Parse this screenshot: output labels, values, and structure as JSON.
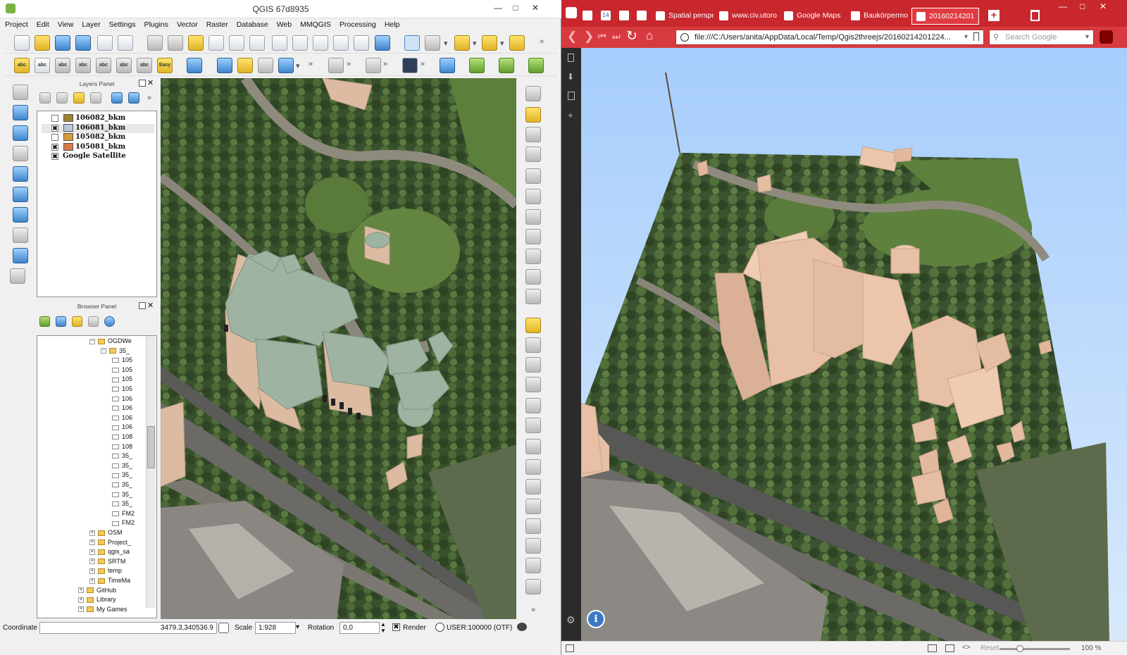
{
  "qgis": {
    "title": "QGIS 67d8935",
    "menu": [
      "Project",
      "Edit",
      "View",
      "Layer",
      "Settings",
      "Plugins",
      "Vector",
      "Raster",
      "Database",
      "Web",
      "MMQGIS",
      "Processing",
      "Help"
    ],
    "toolbar_labels": {
      "abc": "abc",
      "easy": "Easy"
    },
    "layers_panel": {
      "title": "Layers Panel",
      "layers": [
        {
          "name": "106082_bkm",
          "checked": false,
          "color": "#9c8430"
        },
        {
          "name": "106081_bkm",
          "checked": true,
          "color": "#b9c7d9"
        },
        {
          "name": "105082_bkm",
          "checked": false,
          "color": "#d99a3a"
        },
        {
          "name": "105081_bkm",
          "checked": true,
          "color": "#d87a4a"
        },
        {
          "name": "Google Satellite",
          "checked": true,
          "color": ""
        }
      ]
    },
    "browser_panel": {
      "title": "Browser Panel",
      "tree": [
        {
          "label": "OGDWe",
          "indent": 1,
          "type": "folder"
        },
        {
          "label": "35_",
          "indent": 2,
          "type": "folder"
        },
        {
          "label": "105",
          "indent": 3,
          "type": "file"
        },
        {
          "label": "105",
          "indent": 3,
          "type": "file"
        },
        {
          "label": "105",
          "indent": 3,
          "type": "file"
        },
        {
          "label": "105",
          "indent": 3,
          "type": "file"
        },
        {
          "label": "106",
          "indent": 3,
          "type": "file"
        },
        {
          "label": "106",
          "indent": 3,
          "type": "file"
        },
        {
          "label": "106",
          "indent": 3,
          "type": "file"
        },
        {
          "label": "106",
          "indent": 3,
          "type": "file"
        },
        {
          "label": "108",
          "indent": 3,
          "type": "file"
        },
        {
          "label": "108",
          "indent": 3,
          "type": "file"
        },
        {
          "label": "35_",
          "indent": 3,
          "type": "file"
        },
        {
          "label": "35_",
          "indent": 3,
          "type": "file"
        },
        {
          "label": "35_",
          "indent": 3,
          "type": "file"
        },
        {
          "label": "35_",
          "indent": 3,
          "type": "file"
        },
        {
          "label": "35_",
          "indent": 3,
          "type": "file"
        },
        {
          "label": "35_",
          "indent": 3,
          "type": "file"
        },
        {
          "label": "FM2",
          "indent": 3,
          "type": "file"
        },
        {
          "label": "FM2",
          "indent": 3,
          "type": "file"
        },
        {
          "label": "OSM",
          "indent": 1,
          "type": "folder"
        },
        {
          "label": "Project_",
          "indent": 1,
          "type": "folder"
        },
        {
          "label": "qgis_sa",
          "indent": 1,
          "type": "folder"
        },
        {
          "label": "SRTM",
          "indent": 1,
          "type": "folder"
        },
        {
          "label": "temp",
          "indent": 1,
          "type": "folder"
        },
        {
          "label": "TimeMa",
          "indent": 1,
          "type": "folder"
        },
        {
          "label": "GitHub",
          "indent": 0,
          "type": "folder"
        },
        {
          "label": "Library",
          "indent": 0,
          "type": "folder"
        },
        {
          "label": "My Games",
          "indent": 0,
          "type": "folder"
        }
      ]
    },
    "status": {
      "coordinate_label": "Coordinate",
      "coordinate_value": "3479.3,340536.9",
      "scale_label": "Scale",
      "scale_value": "1:928",
      "rotation_label": "Rotation",
      "rotation_value": "0,0",
      "render_label": "Render",
      "render_checked": true,
      "crs_label": "USER:100000 (OTF)"
    }
  },
  "browser": {
    "tabs": [
      {
        "label": "",
        "icon": "gmail-icon"
      },
      {
        "label": "14",
        "icon": "calendar-icon"
      },
      {
        "label": "",
        "icon": "twitter-icon"
      },
      {
        "label": "",
        "icon": "app-icon"
      },
      {
        "label": "Spatial perspe",
        "icon": "spatial-icon"
      },
      {
        "label": "www.civ.utoro",
        "icon": "globe-icon"
      },
      {
        "label": "Google Maps",
        "icon": "maps-icon"
      },
      {
        "label": "Baukörpermo",
        "icon": "web-icon"
      },
      {
        "label": "20160214201",
        "icon": "globe-icon",
        "active": true
      }
    ],
    "url": "file:///C:/Users/anita/AppData/Local/Temp/Qgis2threejs/20160214201224...",
    "search_placeholder": "Search Google",
    "zoom": "100 %",
    "reset_label": "Reset"
  },
  "colors": {
    "browser_accent": "#c8272d",
    "building_map": "#9fb3a3",
    "building_3d": "#e8c0a6"
  }
}
